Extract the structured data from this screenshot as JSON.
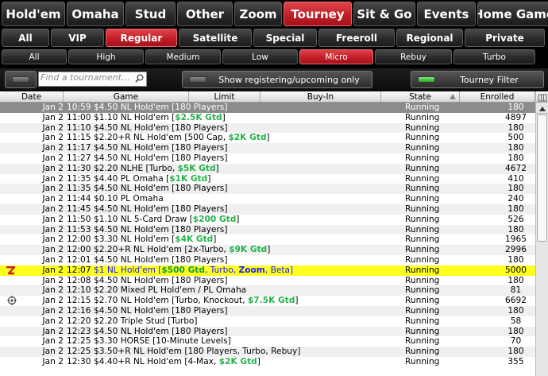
{
  "game_tabs": [
    "Hold'em",
    "Omaha",
    "Stud",
    "Other",
    "Zoom",
    "Tourney",
    "Sit & Go",
    "Events",
    "Home Games"
  ],
  "active_game_tab": 5,
  "category_tabs": [
    "All",
    "VIP",
    "Regular",
    "Satellite",
    "Special",
    "Freeroll",
    "Regional",
    "Private"
  ],
  "active_category_tab": 2,
  "stake_tabs": [
    "All",
    "High",
    "Medium",
    "Low",
    "Micro",
    "Rebuy",
    "Turbo"
  ],
  "active_stake_tab": 4,
  "toolbar": {
    "search_placeholder": "Find a tournament...",
    "show_registering_label": "Show registering/upcoming only",
    "tourney_filter_label": "Tourney Filter"
  },
  "columns": [
    "Date",
    "Game",
    "Limit",
    "Buy-In",
    "State",
    "Enrolled"
  ],
  "rows": [
    {
      "date": "Jan 2",
      "time": "10:59",
      "game": [
        {
          "t": "$4.50 NL Hold'em [180 Players]"
        }
      ],
      "state": "Running",
      "enrolled": "180"
    },
    {
      "date": "Jan 2",
      "time": "11:00",
      "game": [
        {
          "t": "$1.10 NL Hold'em ["
        },
        {
          "t": "$2.5K Gtd",
          "c": "gtd"
        },
        {
          "t": "]"
        }
      ],
      "state": "Running",
      "enrolled": "4897"
    },
    {
      "date": "Jan 2",
      "time": "11:10",
      "game": [
        {
          "t": "$4.50 NL Hold'em [180 Players]"
        }
      ],
      "state": "Running",
      "enrolled": "180"
    },
    {
      "date": "Jan 2",
      "time": "11:15",
      "game": [
        {
          "t": "$2.20+R NL Hold'em [500 Cap, "
        },
        {
          "t": "$2K Gtd",
          "c": "gtd"
        },
        {
          "t": "]"
        }
      ],
      "state": "Running",
      "enrolled": "500"
    },
    {
      "date": "Jan 2",
      "time": "11:17",
      "game": [
        {
          "t": "$4.50 NL Hold'em [180 Players]"
        }
      ],
      "state": "Running",
      "enrolled": "180"
    },
    {
      "date": "Jan 2",
      "time": "11:27",
      "game": [
        {
          "t": "$4.50 NL Hold'em [180 Players]"
        }
      ],
      "state": "Running",
      "enrolled": "180"
    },
    {
      "date": "Jan 2",
      "time": "11:30",
      "game": [
        {
          "t": "$2.20 NLHE [Turbo, "
        },
        {
          "t": "$5K Gtd",
          "c": "gtd"
        },
        {
          "t": "]"
        }
      ],
      "state": "Running",
      "enrolled": "4672"
    },
    {
      "date": "Jan 2",
      "time": "11:35",
      "game": [
        {
          "t": "$4.40 PL Omaha ["
        },
        {
          "t": "$1K Gtd",
          "c": "gtd"
        },
        {
          "t": "]"
        }
      ],
      "state": "Running",
      "enrolled": "410"
    },
    {
      "date": "Jan 2",
      "time": "11:35",
      "game": [
        {
          "t": "$4.50 NL Hold'em [180 Players]"
        }
      ],
      "state": "Running",
      "enrolled": "180"
    },
    {
      "date": "Jan 2",
      "time": "11:44",
      "game": [
        {
          "t": "$0.10 PL Omaha"
        }
      ],
      "state": "Running",
      "enrolled": "240"
    },
    {
      "date": "Jan 2",
      "time": "11:45",
      "game": [
        {
          "t": "$4.50 NL Hold'em [180 Players]"
        }
      ],
      "state": "Running",
      "enrolled": "180"
    },
    {
      "date": "Jan 2",
      "time": "11:50",
      "game": [
        {
          "t": "$1.10 NL 5-Card Draw ["
        },
        {
          "t": "$200 Gtd",
          "c": "gtd"
        },
        {
          "t": "]"
        }
      ],
      "state": "Running",
      "enrolled": "526"
    },
    {
      "date": "Jan 2",
      "time": "11:53",
      "game": [
        {
          "t": "$4.50 NL Hold'em [180 Players]"
        }
      ],
      "state": "Running",
      "enrolled": "180"
    },
    {
      "date": "Jan 2",
      "time": "12:00",
      "game": [
        {
          "t": "$3.30 NL Hold'em ["
        },
        {
          "t": "$4K Gtd",
          "c": "gtd"
        },
        {
          "t": "]"
        }
      ],
      "state": "Running",
      "enrolled": "1965"
    },
    {
      "date": "Jan 2",
      "time": "12:00",
      "game": [
        {
          "t": "$2.20+R NL Hold'em [2x-Turbo, "
        },
        {
          "t": "$9K Gtd",
          "c": "gtd"
        },
        {
          "t": "]"
        }
      ],
      "state": "Running",
      "enrolled": "2996"
    },
    {
      "date": "Jan 2",
      "time": "12:01",
      "game": [
        {
          "t": "$4.50 NL Hold'em [180 Players]"
        }
      ],
      "state": "Running",
      "enrolled": "180"
    },
    {
      "date": "Jan 2",
      "time": "12:07",
      "highlight": true,
      "icon": "zoom-z",
      "game": [
        {
          "t": "$1 NL Hold'em [",
          "c": "blue"
        },
        {
          "t": "$500 Gtd",
          "c": "greenbold"
        },
        {
          "t": ", Turbo, ",
          "c": "blue"
        },
        {
          "t": "Zoom",
          "c": "bluebold"
        },
        {
          "t": ", Beta]",
          "c": "blue"
        }
      ],
      "state": "Running",
      "enrolled": "5000"
    },
    {
      "date": "Jan 2",
      "time": "12:08",
      "game": [
        {
          "t": "$4.50 NL Hold'em [180 Players]"
        }
      ],
      "state": "Running",
      "enrolled": "180"
    },
    {
      "date": "Jan 2",
      "time": "12:10",
      "game": [
        {
          "t": "$2.20 Mixed PL Hold'em / PL Omaha"
        }
      ],
      "state": "Running",
      "enrolled": "81"
    },
    {
      "date": "Jan 2",
      "time": "12:15",
      "icon": "target",
      "game": [
        {
          "t": "$2.70 NL Hold'em [Turbo, Knockout, "
        },
        {
          "t": "$7.5K Gtd",
          "c": "gtd"
        },
        {
          "t": "]"
        }
      ],
      "state": "Running",
      "enrolled": "6692"
    },
    {
      "date": "Jan 2",
      "time": "12:16",
      "game": [
        {
          "t": "$4.50 NL Hold'em [180 Players]"
        }
      ],
      "state": "Running",
      "enrolled": "180"
    },
    {
      "date": "Jan 2",
      "time": "12:20",
      "game": [
        {
          "t": "$2.20 Triple Stud [Turbo]"
        }
      ],
      "state": "Running",
      "enrolled": "58"
    },
    {
      "date": "Jan 2",
      "time": "12:23",
      "game": [
        {
          "t": "$4.50 NL Hold'em [180 Players]"
        }
      ],
      "state": "Running",
      "enrolled": "180"
    },
    {
      "date": "Jan 2",
      "time": "12:25",
      "game": [
        {
          "t": "$3.30 HORSE [10-Minute Levels]"
        }
      ],
      "state": "Running",
      "enrolled": "70"
    },
    {
      "date": "Jan 2",
      "time": "12:25",
      "game": [
        {
          "t": "$3.50+R NL Hold'em [180 Players, Turbo, Rebuy]"
        }
      ],
      "state": "Running",
      "enrolled": "180"
    },
    {
      "date": "Jan 2",
      "time": "12:30",
      "game": [
        {
          "t": "$4.40+R NL Hold'em [4-Max, "
        },
        {
          "t": "$2K Gtd",
          "c": "gtd"
        },
        {
          "t": "]"
        }
      ],
      "state": "Running",
      "enrolled": "355"
    }
  ]
}
